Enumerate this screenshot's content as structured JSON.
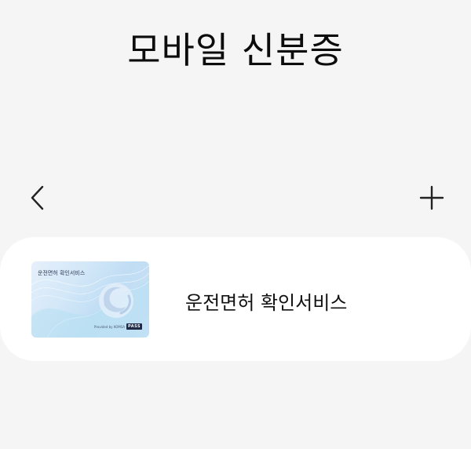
{
  "page": {
    "title": "모바일 신분증"
  },
  "nav": {
    "back_icon": "chevron-left-icon",
    "add_icon": "plus-icon"
  },
  "card": {
    "label": "운전면허 확인서비스",
    "thumbnail": {
      "title": "운전면허 확인서비스",
      "provided_by": "Provided by KOMSA",
      "badge": "PASS"
    }
  },
  "colors": {
    "background": "#f5f5f5",
    "card_background": "#ffffff",
    "text": "#111111",
    "thumbnail_blue": "#c0ddf4"
  }
}
